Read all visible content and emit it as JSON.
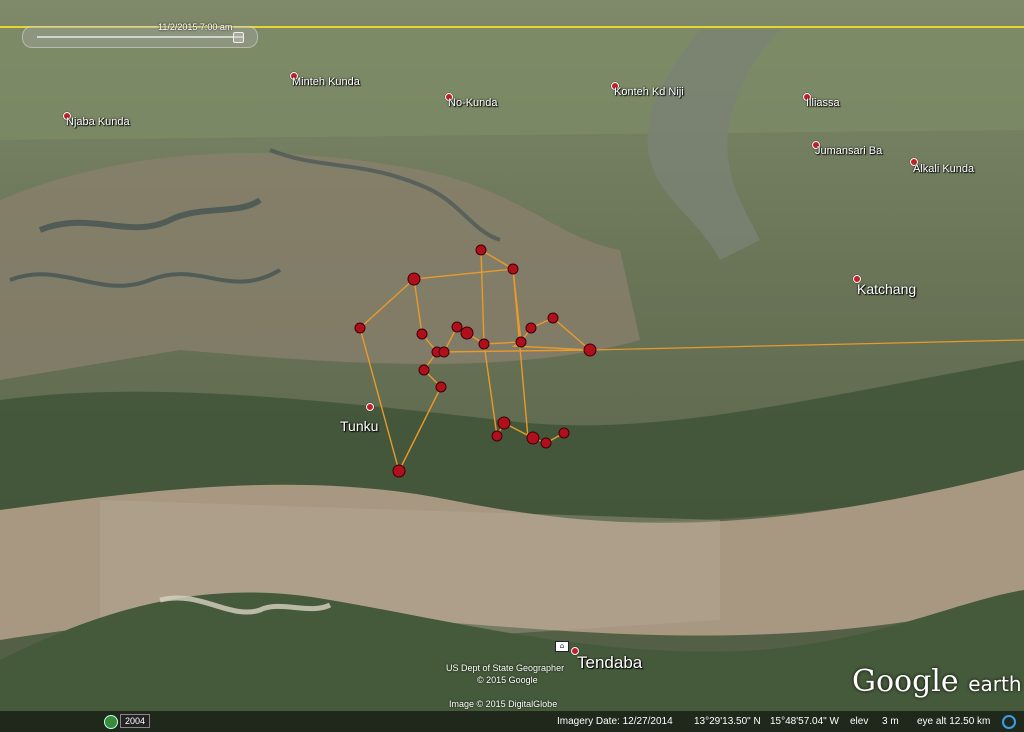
{
  "time_slider": {
    "label": "11/2/2015  7:00 am"
  },
  "places": [
    {
      "name": "Njaba Kunda"
    },
    {
      "name": "Minteh Kunda"
    },
    {
      "name": "No-Kunda"
    },
    {
      "name": "Konteh Kd Niji"
    },
    {
      "name": "Illiassa"
    },
    {
      "name": "Jumansari Ba"
    },
    {
      "name": "Alkali Kunda"
    },
    {
      "name": "Katchang"
    },
    {
      "name": "Tunku"
    },
    {
      "name": "Tendaba"
    }
  ],
  "credits": {
    "line1": "US Dept of State Geographer",
    "line2": "© 2015 Google",
    "line3": "Image © 2015 DigitalGlobe"
  },
  "logo": {
    "brand": "Google",
    "product": "earth"
  },
  "status_bar": {
    "year": "2004",
    "imagery_date": "Imagery Date: 12/27/2014",
    "lat": "13°29'13.50\" N",
    "lon": "15°48'57.04\" W",
    "elev_label": "elev",
    "elev_value": "3 m",
    "eye_alt": "eye alt  12.50 km"
  },
  "colors": {
    "track": "#e89a2c",
    "waypoint": "#b0101c",
    "boundary": "#e8d430",
    "river": "#a89882"
  },
  "icons": {
    "history": "clock-history-icon",
    "streaming": "streaming-circle-icon",
    "hotel": "hotel-icon"
  }
}
